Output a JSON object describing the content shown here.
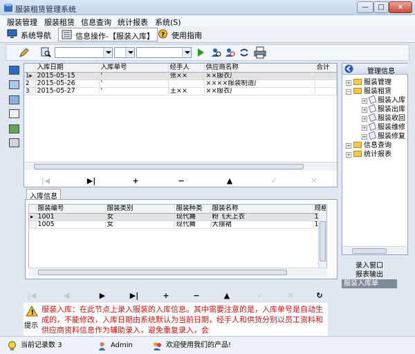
{
  "window": {
    "title": "服装租赁管理系统",
    "minimize": "—",
    "maximize": "□",
    "close": "×"
  },
  "menu": [
    "服装管理",
    "服装租赁",
    "信息查询",
    "统计报表",
    "系统(S)"
  ],
  "toolbar_tabs": {
    "nav": "系统导航",
    "current": "信息操作-【服装入库】",
    "guide": "使用指南"
  },
  "main_grid": {
    "columns": [
      "入库日期",
      "入库单号",
      "经手人",
      "供应商名称",
      "合计"
    ],
    "rows": [
      {
        "no": "1",
        "date": "2015-05-15",
        "order": "'",
        "handler": "张××",
        "supplier": "××服衣厂",
        "total": ""
      },
      {
        "no": "2",
        "date": "2015-05-26",
        "order": "'",
        "handler": "",
        "supplier": "××××服装制造厂",
        "total": ""
      },
      {
        "no": "3",
        "date": "2015-05-27",
        "order": "'",
        "handler": "王××",
        "supplier": "××服衣厂",
        "total": ""
      }
    ]
  },
  "nav_main": {
    "first": "|◀",
    "last": "▶|",
    "add": "+",
    "del": "−",
    "check": "✓",
    "cancel": "✕"
  },
  "detail": {
    "tab": "入库信息",
    "columns": [
      "服装编号",
      "服装类别",
      "服装种类",
      "服装名称",
      "规格"
    ],
    "rows": [
      {
        "code": "1001",
        "cat": "女",
        "kind": "现代舞",
        "name": "粉飞天上衣",
        "spec": "122"
      },
      {
        "code": "1005",
        "cat": "女",
        "kind": "现代舞",
        "name": "大摆裙",
        "spec": "122"
      }
    ]
  },
  "nav_detail": {
    "first": "|◀",
    "prev": "◀",
    "next": "▶",
    "last": "▶|",
    "add": "+",
    "del": "−",
    "up": "▲",
    "check": "✓",
    "cancel": "✕",
    "refresh": "↻"
  },
  "tree": {
    "header": "管理信息",
    "nodes": [
      {
        "label": "服装管理",
        "pm": "+"
      },
      {
        "label": "服装租赁",
        "pm": "−"
      },
      {
        "label": "服装入库"
      },
      {
        "label": "服装出库"
      },
      {
        "label": "服装收回"
      },
      {
        "label": "服装维修"
      },
      {
        "label": "服装修复"
      },
      {
        "label": "信息查询",
        "pm": "+"
      },
      {
        "label": "统计报表",
        "pm": "+"
      }
    ]
  },
  "quick_list": [
    "录入窗口",
    "报表输出",
    "服装入库单"
  ],
  "hint": {
    "label": "提示",
    "text": "服装入库：在此节点上录入服装的入库信息。其中需要注意的是，入库单号是自动生成的，不能修改，入库日期由系统默认为当前日期，经手人和供货分别以员工资料和供应商资料信息作为辅助录入，避免重复录入，会"
  },
  "status": {
    "records_label": "当前记录数",
    "records": "3",
    "user": "Admin",
    "welcome": "欢迎使用我们的产品!"
  },
  "colors": {
    "accent": "#8ea3c3",
    "hint_text": "#cc1111",
    "selected": "#7f8a99"
  }
}
